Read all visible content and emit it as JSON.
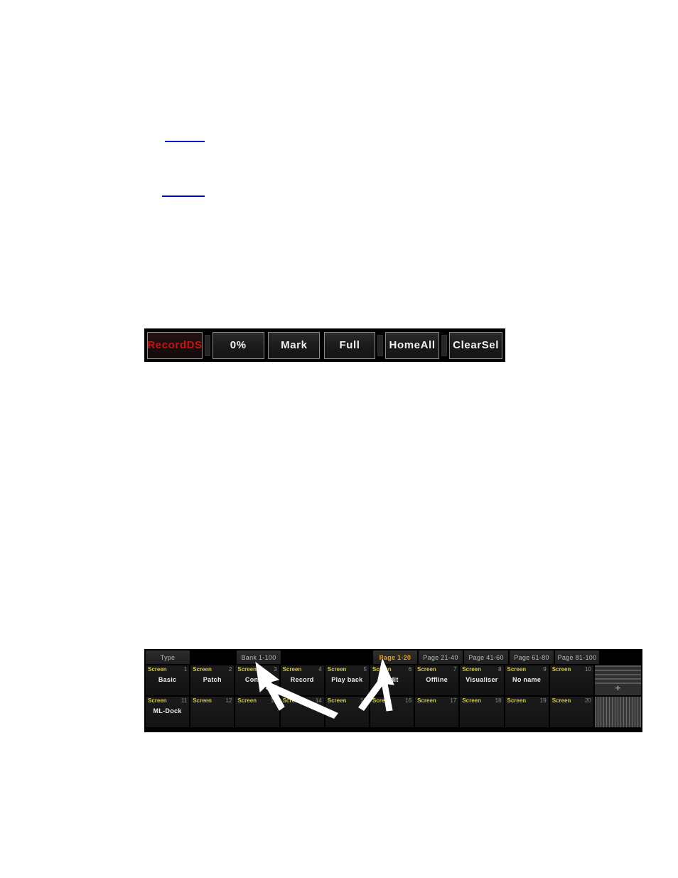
{
  "page": {
    "background": "#ffffff",
    "link_color": "#0000cc"
  },
  "links": [
    {
      "name": "hyperlink-rule-1",
      "text": ""
    },
    {
      "name": "hyperlink-rule-2",
      "text": ""
    }
  ],
  "toolbar": {
    "name": "console-button-bar",
    "background": "#000000",
    "buttons": [
      {
        "label": "RecordDS",
        "color": "#cc1111",
        "state": "highlighted"
      },
      {
        "label": "0%",
        "color": "#f2f2f2",
        "state": "normal"
      },
      {
        "label": "Mark",
        "color": "#f2f2f2",
        "state": "normal"
      },
      {
        "label": "Full",
        "color": "#f2f2f2",
        "state": "normal"
      },
      {
        "label": "HomeAll",
        "color": "#f2f2f2",
        "state": "normal"
      },
      {
        "label": "ClearSel",
        "color": "#f2f2f2",
        "state": "normal"
      }
    ]
  },
  "screens_panel": {
    "name": "screen-selection-window",
    "accent_color": "#e8a317",
    "label_color": "#d3c843",
    "header": {
      "type_label": "Type",
      "bank_label": "Bank 1-100",
      "pages": [
        {
          "label": "Page 1-20",
          "active": true
        },
        {
          "label": "Page 21-40",
          "active": false
        },
        {
          "label": "Page 41-60",
          "active": false
        },
        {
          "label": "Page 61-80",
          "active": false
        },
        {
          "label": "Page 81-100",
          "active": false
        }
      ]
    },
    "cell_label": "Screen",
    "row1": [
      {
        "num": "1",
        "name": "Basic"
      },
      {
        "num": "2",
        "name": "Patch"
      },
      {
        "num": "3",
        "name": "Control"
      },
      {
        "num": "4",
        "name": "Record"
      },
      {
        "num": "5",
        "name": "Play back"
      },
      {
        "num": "6",
        "name": "Edit"
      },
      {
        "num": "7",
        "name": "Offline"
      },
      {
        "num": "8",
        "name": "Visualiser"
      },
      {
        "num": "9",
        "name": "No name"
      },
      {
        "num": "10",
        "name": ""
      }
    ],
    "row2": [
      {
        "num": "11",
        "name": "ML-Dock"
      },
      {
        "num": "12",
        "name": ""
      },
      {
        "num": "13",
        "name": ""
      },
      {
        "num": "14",
        "name": ""
      },
      {
        "num": "15",
        "name": ""
      },
      {
        "num": "16",
        "name": ""
      },
      {
        "num": "17",
        "name": ""
      },
      {
        "num": "18",
        "name": ""
      },
      {
        "num": "19",
        "name": ""
      },
      {
        "num": "20",
        "name": ""
      }
    ],
    "widgets": {
      "add_button_glyph": "+",
      "lines_widget_name": "screen-lines-thumbnail",
      "grid_widget_name": "screen-grid-thumbnail"
    }
  },
  "annotations": {
    "arrow_color": "#ffffff",
    "arrows": [
      {
        "name": "callout-arrow-bank",
        "points_to": "Bank 1-100"
      },
      {
        "name": "callout-arrow-page",
        "points_to": "Page 1-20"
      }
    ]
  }
}
